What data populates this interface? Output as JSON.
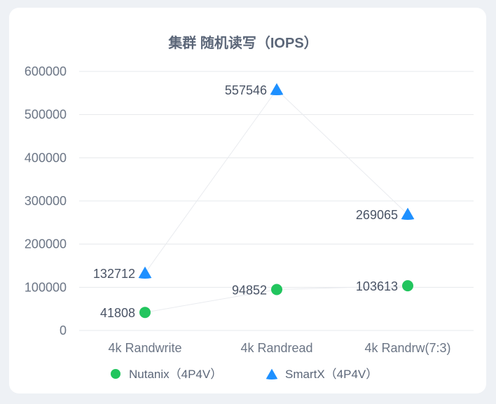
{
  "chart_data": {
    "type": "scatter",
    "title": "集群 随机读写（IOPS）",
    "categories": [
      "4k Randwrite",
      "4k Randread",
      "4k Randrw(7:3)"
    ],
    "y_ticks": [
      "600000",
      "500000",
      "400000",
      "300000",
      "200000",
      "100000",
      "0"
    ],
    "ylim": [
      0,
      600000
    ],
    "grid": true,
    "legend_position": "bottom",
    "series": [
      {
        "name": "Nutanix（4P4V）",
        "marker": "circle",
        "color": "#22c55e",
        "values": [
          41808,
          94852,
          103613
        ],
        "labels": [
          "41808",
          "94852",
          "103613"
        ]
      },
      {
        "name": "SmartX（4P4V）",
        "marker": "triangle",
        "color": "#1e90ff",
        "values": [
          132712,
          557546,
          269065
        ],
        "labels": [
          "132712",
          "557546",
          "269065"
        ]
      }
    ]
  }
}
